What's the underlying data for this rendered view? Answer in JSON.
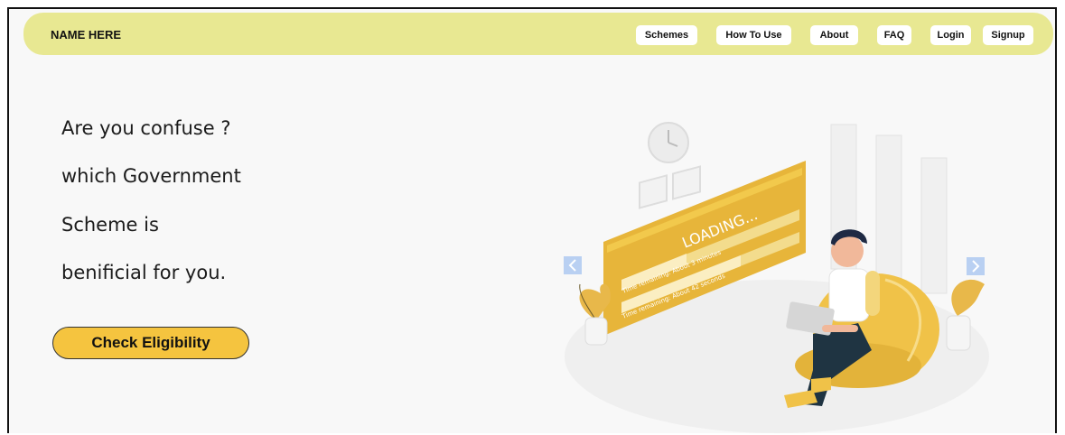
{
  "navbar": {
    "brand": "NAME HERE",
    "links": [
      "Schemes",
      "How To Use",
      "About",
      "FAQ",
      "Login",
      "Signup"
    ]
  },
  "hero": {
    "line1": "Are you confuse ?",
    "line2": "which Government",
    "line3": "Scheme is",
    "line4": "benificial for you.",
    "cta_label": "Check Eligibility"
  },
  "illustration": {
    "loading_text": "LOADING...",
    "time_remaining_1": "Time remaining: About 3 minutes",
    "time_remaining_2": "Time remaining: About 42 seconds"
  },
  "colors": {
    "navbar_bg": "#e8e892",
    "accent_yellow": "#f5c43f",
    "carousel_arrow": "#b9d0f2"
  },
  "icons": [
    "chevron-left-icon",
    "chevron-right-icon"
  ]
}
